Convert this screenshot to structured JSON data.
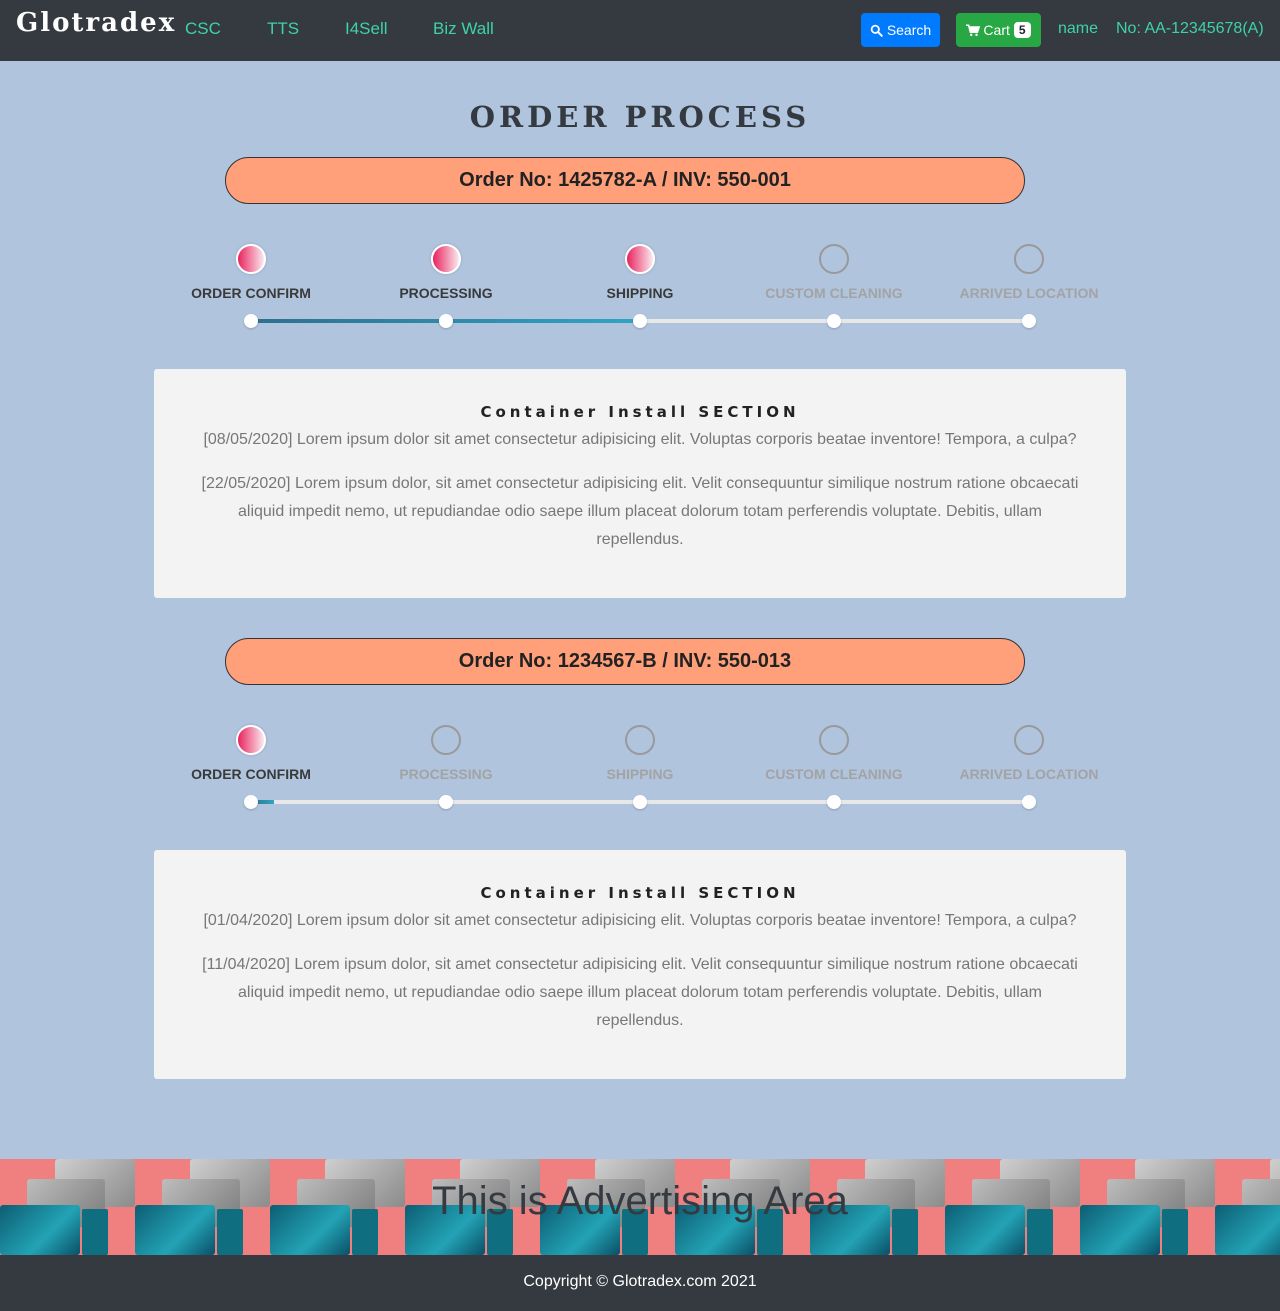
{
  "navbar": {
    "brand": "Glotradex",
    "links": [
      "CSC",
      "TTS",
      "I4Sell",
      "Biz Wall"
    ],
    "search_label": "Search",
    "cart_label": "Cart",
    "cart_count": "5",
    "user_name": "name",
    "user_no": "No: AA-12345678(A)",
    "accent_color": "#3fd2a8"
  },
  "page_title": "ORDER PROCESS",
  "steps": [
    "ORDER CONFIRM",
    "PROCESSING",
    "SHIPPING",
    "CUSTOM CLEANING",
    "ARRIVED LOCATION"
  ],
  "orders": [
    {
      "header": "Order No: 1425782-A / INV: 550-001",
      "completed_steps": 3,
      "progress_fraction": 0.5,
      "section_title": "Container Install SECTION",
      "note1": "[08/05/2020] Lorem ipsum dolor sit amet consectetur adipisicing elit. Voluptas corporis beatae inventore! Tempora, a culpa?",
      "note2": "[22/05/2020] Lorem ipsum dolor, sit amet consectetur adipisicing elit. Velit consequuntur similique nostrum ratione obcaecati aliquid impedit nemo, ut repudiandae odio saepe illum placeat dolorum totam perferendis voluptate. Debitis, ullam repellendus."
    },
    {
      "header": "Order No: 1234567-B / INV: 550-013",
      "completed_steps": 1,
      "progress_fraction": 0.03,
      "section_title": "Container Install SECTION",
      "note1": "[01/04/2020] Lorem ipsum dolor sit amet consectetur adipisicing elit. Voluptas corporis beatae inventore! Tempora, a culpa?",
      "note2": "[11/04/2020] Lorem ipsum dolor, sit amet consectetur adipisicing elit. Velit consequuntur similique nostrum ratione obcaecati aliquid impedit nemo, ut repudiandae odio saepe illum placeat dolorum totam perferendis voluptate. Debitis, ullam repellendus."
    }
  ],
  "advertising": {
    "text": "This is Advertising Area",
    "background": "#f08080"
  },
  "footer": {
    "copyright": "Copyright © Glotradex.com 2021"
  }
}
